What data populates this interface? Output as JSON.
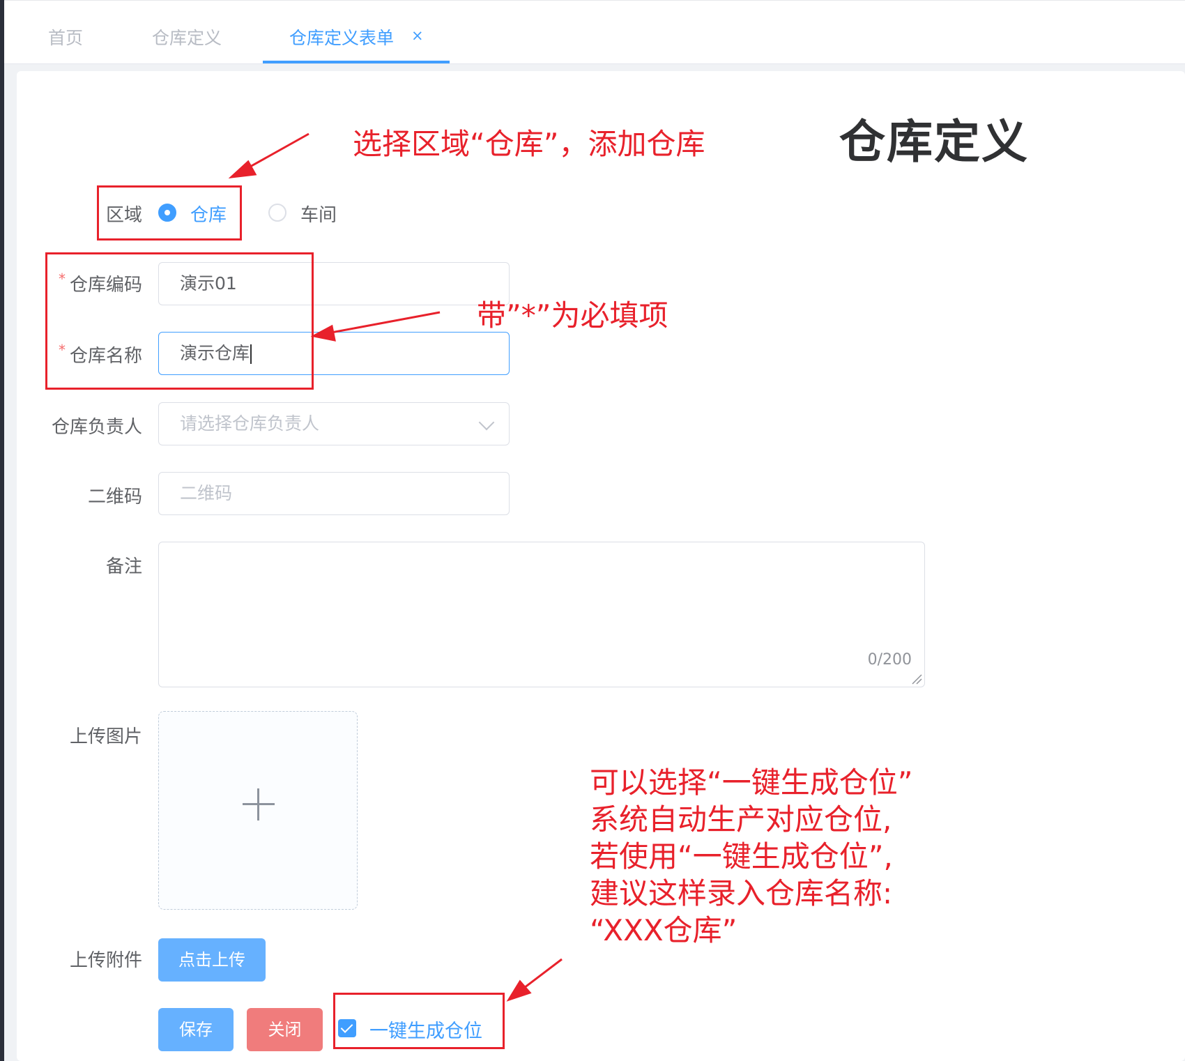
{
  "tabs": [
    {
      "label": "首页"
    },
    {
      "label": "仓库定义"
    },
    {
      "label": "仓库定义表单",
      "close": "×"
    }
  ],
  "page_title": "仓库定义",
  "form": {
    "area": {
      "label": "区域",
      "options": [
        {
          "label": "仓库",
          "checked": true
        },
        {
          "label": "车间",
          "checked": false
        }
      ]
    },
    "warehouse_code": {
      "label": "仓库编码",
      "required": "*",
      "value": "演示01"
    },
    "warehouse_name": {
      "label": "仓库名称",
      "required": "*",
      "value": "演示仓库"
    },
    "warehouse_manager": {
      "label": "仓库负责人",
      "placeholder": "请选择仓库负责人"
    },
    "qr_code": {
      "label": "二维码",
      "placeholder": "二维码"
    },
    "remark": {
      "label": "备注",
      "counter": "0/200"
    },
    "upload_image": {
      "label": "上传图片"
    },
    "upload_attachment": {
      "label": "上传附件",
      "button": "点击上传"
    }
  },
  "actions": {
    "save": "保存",
    "close": "关闭",
    "auto_generate": {
      "label": "一键生成仓位",
      "checked": true
    }
  },
  "annotations": {
    "area_note": "选择区域“仓库”，添加仓库",
    "required_note": "带”*”为必填项",
    "auto_note_lines": [
      "可以选择“一键生成仓位”",
      "系统自动生产对应仓位,",
      "若使用“一键生成仓位”,",
      "建议这样录入仓库名称:",
      "“XXX仓库”"
    ]
  },
  "colors": {
    "accent": "#409eff",
    "danger": "#f07c7c",
    "annotation": "#e8212b"
  }
}
